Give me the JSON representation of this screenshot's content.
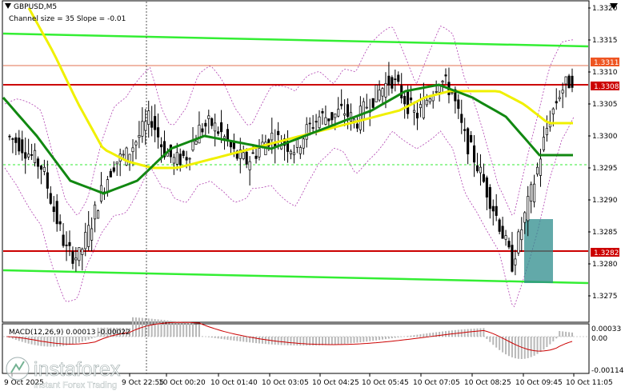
{
  "header": {
    "symbol": "GBPUSD,M5",
    "indicator": "Channel size = 35 Slope = -0.01"
  },
  "macd": {
    "label": "MACD(12,26,9) 0.00013 -0.00022",
    "ticks": [
      "0.00033",
      "0.00",
      "-0.00114"
    ]
  },
  "watermark": {
    "brand": "instaforex",
    "tagline": "Instant Forex Trading"
  },
  "colors": {
    "resistance": "#cc0000",
    "support_tag": "#cc0000",
    "channel": "#33ee33",
    "ma_fast": "#f0f000",
    "ma_slow": "#118811",
    "bands": "#b040b0",
    "highlight": "#2e8c8c",
    "macd_hist": "#b8b8b8",
    "macd_signal": "#cc0000"
  },
  "chart_data": {
    "type": "candlestick",
    "symbol": "GBPUSD",
    "timeframe": "M5",
    "ylim": [
      1.3271,
      1.3321
    ],
    "y_ticks": [
      1.332,
      1.3315,
      1.331,
      1.3305,
      1.33,
      1.3295,
      1.329,
      1.3285,
      1.328,
      1.3275
    ],
    "y_tick_labels": [
      "1.3320",
      "1.3315",
      "1.3310",
      "1.3305",
      "1.3300",
      "1.3295",
      "1.3290",
      "1.3285",
      "1.3280",
      "1.3275"
    ],
    "x_tick_labels": [
      "9 Oct 2025",
      "9 Oct 22:55",
      "10 Oct 00:20",
      "10 Oct 01:40",
      "10 Oct 03:05",
      "10 Oct 04:25",
      "10 Oct 05:45",
      "10 Oct 07:05",
      "10 Oct 08:25",
      "10 Oct 09:45",
      "10 Oct 11:05"
    ],
    "price_labels": [
      {
        "text": "1.3311",
        "value": 1.3311,
        "style": "orange"
      },
      {
        "text": "1.3308",
        "value": 1.3308,
        "style": "red"
      },
      {
        "text": "1.3282",
        "value": 1.3282,
        "style": "red"
      }
    ],
    "horizontal_levels": [
      {
        "value": 1.3308,
        "kind": "resistance"
      },
      {
        "value": 1.3282,
        "kind": "support"
      },
      {
        "value": 1.3311,
        "kind": "thin"
      }
    ],
    "channel_upper": [
      1.3316,
      1.3314
    ],
    "channel_lower": [
      1.3279,
      1.3277
    ],
    "closes": [
      1.33,
      1.3299,
      1.3297,
      1.3295,
      1.3288,
      1.3282,
      1.3281,
      1.3286,
      1.3292,
      1.3296,
      1.3297,
      1.33,
      1.3303,
      1.3298,
      1.3296,
      1.3297,
      1.3301,
      1.3302,
      1.33,
      1.3297,
      1.3296,
      1.3298,
      1.33,
      1.3299,
      1.3298,
      1.3301,
      1.3303,
      1.3303,
      1.3304,
      1.3302,
      1.3305,
      1.3307,
      1.3309,
      1.3306,
      1.3303,
      1.3306,
      1.3309,
      1.3307,
      1.33,
      1.3296,
      1.3291,
      1.3286,
      1.328,
      1.3287,
      1.3294,
      1.3302,
      1.3307,
      1.3309
    ],
    "ma_fast": [
      1.332,
      1.3313,
      1.3305,
      1.3298,
      1.3296,
      1.3295,
      1.3295,
      1.3296,
      1.3297,
      1.3298,
      1.3299,
      1.33,
      1.3301,
      1.3302,
      1.3303,
      1.3304,
      1.3306,
      1.3307,
      1.3307,
      1.3307,
      1.3305,
      1.3302,
      1.3302
    ],
    "ma_slow": [
      1.3306,
      1.33,
      1.3293,
      1.3291,
      1.3293,
      1.3298,
      1.33,
      1.3299,
      1.3298,
      1.33,
      1.3302,
      1.3304,
      1.3307,
      1.3308,
      1.3306,
      1.3303,
      1.3297,
      1.3297
    ],
    "highlight_box": {
      "from": 1.3277,
      "to": 1.3287
    }
  }
}
